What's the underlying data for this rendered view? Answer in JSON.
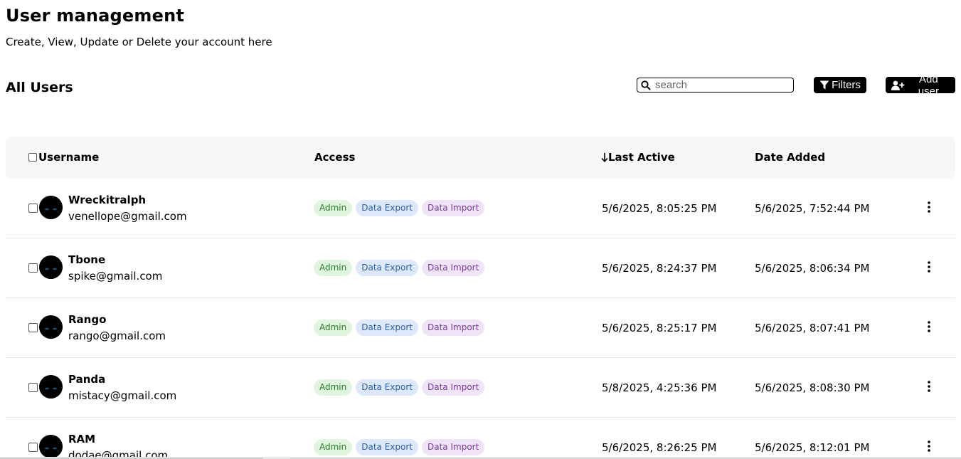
{
  "header": {
    "title": "User management",
    "subtitle": "Create, View, Update or Delete your account here"
  },
  "toolbar": {
    "section_title": "All Users",
    "search_placeholder": "search",
    "search_value": "",
    "filters_label": "Filters",
    "add_user_label": "Add user"
  },
  "table": {
    "columns": {
      "username": "Username",
      "access": "Access",
      "last_active": "Last Active",
      "last_active_sort_icon": "arrow-down-icon",
      "date_added": "Date Added"
    },
    "rows": [
      {
        "username": "Wreckitralph",
        "email": "venellope@gmail.com",
        "access": [
          "Admin",
          "Data Export",
          "Data Import"
        ],
        "last_active": "5/6/2025, 8:05:25 PM",
        "date_added": "5/6/2025, 7:52:44 PM"
      },
      {
        "username": "Tbone",
        "email": "spike@gmail.com",
        "access": [
          "Admin",
          "Data Export",
          "Data Import"
        ],
        "last_active": "5/6/2025, 8:24:37 PM",
        "date_added": "5/6/2025, 8:06:34 PM"
      },
      {
        "username": "Rango",
        "email": "rango@gmail.com",
        "access": [
          "Admin",
          "Data Export",
          "Data Import"
        ],
        "last_active": "5/6/2025, 8:25:17 PM",
        "date_added": "5/6/2025, 8:07:41 PM"
      },
      {
        "username": "Panda",
        "email": "mistacy@gmail.com",
        "access": [
          "Admin",
          "Data Export",
          "Data Import"
        ],
        "last_active": "5/8/2025, 4:25:36 PM",
        "date_added": "5/6/2025, 8:08:30 PM"
      },
      {
        "username": "RAM",
        "email": "dodae@gmail.com",
        "access": [
          "Admin",
          "Data Export",
          "Data Import"
        ],
        "last_active": "5/6/2025, 8:26:25 PM",
        "date_added": "5/6/2025, 8:12:01 PM"
      }
    ]
  },
  "colors": {
    "admin_bg": "#dff5dd",
    "admin_text": "#2f7a34",
    "export_bg": "#dde9fb",
    "export_text": "#2b5fa6",
    "import_bg": "#efe3f7",
    "import_text": "#7a3a97",
    "button_bg": "#000000",
    "header_bg": "#f7f7f7"
  }
}
